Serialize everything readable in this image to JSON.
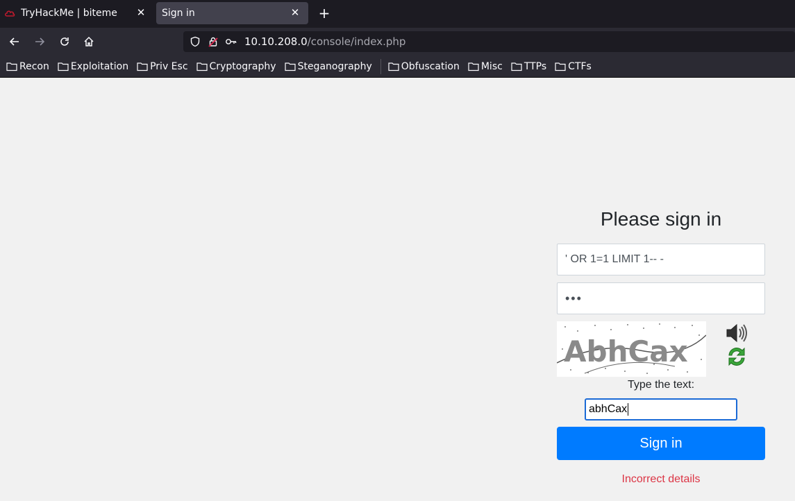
{
  "tabs": [
    {
      "title": "TryHackMe | biteme",
      "favicon": "tryhackme-cloud-icon",
      "active": false
    },
    {
      "title": "Sign in",
      "active": true
    }
  ],
  "nav": {
    "url_host": "10.10.208.0",
    "url_path": "/console/index.php"
  },
  "bookmarks": [
    "Recon",
    "Exploitation",
    "Priv Esc",
    "Cryptography",
    "Steganography",
    "Obfuscation",
    "Misc",
    "TTPs",
    "CTFs"
  ],
  "login": {
    "heading": "Please sign in",
    "username_value": "' OR 1=1 LIMIT 1-- -",
    "password_mask": "•••",
    "captcha_text": "AbhCax",
    "captcha_label": "Type the text:",
    "captcha_input_value": "abhCax",
    "submit_label": "Sign in",
    "error_message": "Incorrect details"
  },
  "colors": {
    "primary": "#007bff",
    "error": "#dc3545",
    "page_bg": "#f1f1f1",
    "chrome_dark": "#1c1b22",
    "chrome": "#2b2a33"
  }
}
